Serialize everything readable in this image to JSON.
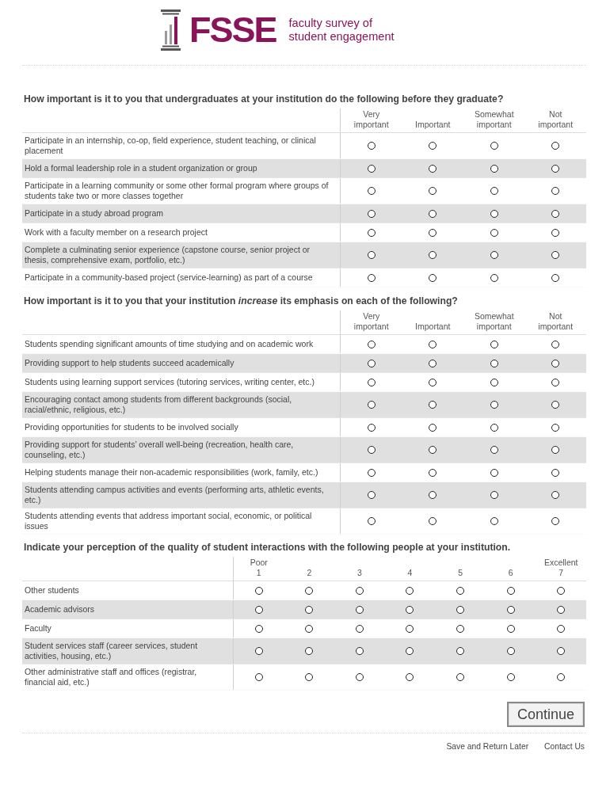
{
  "logo": {
    "acronym": "FSSE",
    "tagline": "faculty survey of student engagement"
  },
  "sections": [
    {
      "kind": "importance",
      "question": "How important is it to you that undergraduates at your institution do the following before they graduate?",
      "columns": [
        {
          "label": "Very important"
        },
        {
          "label": "Important"
        },
        {
          "label": "Somewhat important"
        },
        {
          "label": "Not important"
        }
      ],
      "rows": [
        {
          "label": "Participate in an internship, co-op, field experience, student teaching, or clinical placement",
          "selected": [
            false,
            false,
            false,
            false
          ]
        },
        {
          "label": "Hold a formal leadership role in a student organization or group",
          "selected": [
            false,
            false,
            false,
            false
          ]
        },
        {
          "label": "Participate in a learning community or some other formal program where groups of students take two or more classes together",
          "selected": [
            false,
            false,
            false,
            false
          ]
        },
        {
          "label": "Participate in a study abroad program",
          "selected": [
            false,
            false,
            false,
            false
          ]
        },
        {
          "label": "Work with a faculty member on a research project",
          "selected": [
            false,
            false,
            false,
            false
          ]
        },
        {
          "label": "Complete a culminating senior experience (capstone course, senior project or thesis, comprehensive exam, portfolio, etc.)",
          "selected": [
            false,
            false,
            false,
            false
          ]
        },
        {
          "label": "Participate in a community-based project (service-learning) as part of a course",
          "selected": [
            false,
            false,
            false,
            false
          ]
        }
      ]
    },
    {
      "kind": "importance",
      "question": "How important is it to you that your institution *increase* its emphasis on each of the following?",
      "columns": [
        {
          "label": "Very important"
        },
        {
          "label": "Important"
        },
        {
          "label": "Somewhat important"
        },
        {
          "label": "Not important"
        }
      ],
      "rows": [
        {
          "label": "Students spending significant amounts of time studying and on academic work",
          "selected": [
            false,
            false,
            false,
            false
          ]
        },
        {
          "label": "Providing support to help students succeed academically",
          "selected": [
            false,
            false,
            false,
            false
          ]
        },
        {
          "label": "Students using learning support services (tutoring services, writing center, etc.)",
          "selected": [
            false,
            false,
            false,
            false
          ]
        },
        {
          "label": "Encouraging contact among students from different backgrounds (social, racial/ethnic, religious, etc.)",
          "selected": [
            false,
            false,
            false,
            false
          ]
        },
        {
          "label": "Providing opportunities for students to be involved socially",
          "selected": [
            false,
            false,
            false,
            false
          ]
        },
        {
          "label": "Providing support for students’ overall well-being (recreation, health care, counseling, etc.)",
          "selected": [
            false,
            false,
            false,
            false
          ]
        },
        {
          "label": "Helping students manage their non-academic responsibilities (work, family, etc.)",
          "selected": [
            false,
            false,
            false,
            false
          ]
        },
        {
          "label": "Students attending campus activities and events (performing arts, athletic events, etc.)",
          "selected": [
            false,
            false,
            false,
            false
          ]
        },
        {
          "label": "Students attending events that address important social, economic, or political issues",
          "selected": [
            false,
            false,
            false,
            false
          ]
        }
      ]
    },
    {
      "kind": "rating",
      "question": "Indicate your perception of the quality of student interactions with the following people at your institution.",
      "columns": [
        {
          "anchor": "Poor",
          "label": "1"
        },
        {
          "label": "2"
        },
        {
          "label": "3"
        },
        {
          "label": "4"
        },
        {
          "label": "5"
        },
        {
          "label": "6"
        },
        {
          "anchor": "Excellent",
          "label": "7"
        }
      ],
      "rows": [
        {
          "label": "Other students",
          "selected": [
            false,
            false,
            false,
            false,
            false,
            false,
            false
          ]
        },
        {
          "label": "Academic advisors",
          "selected": [
            false,
            false,
            false,
            false,
            false,
            false,
            false
          ]
        },
        {
          "label": "Faculty",
          "selected": [
            false,
            false,
            false,
            false,
            false,
            false,
            false
          ]
        },
        {
          "label": "Student services staff (career services, student activities, housing, etc.)",
          "selected": [
            false,
            false,
            false,
            false,
            false,
            false,
            false
          ]
        },
        {
          "label": "Other administrative staff and offices (registrar, financial aid, etc.)",
          "selected": [
            false,
            false,
            false,
            false,
            false,
            false,
            false
          ]
        }
      ]
    }
  ],
  "continue_button": "Continue",
  "footer_links": [
    "Save and Return Later",
    "Contact Us"
  ]
}
